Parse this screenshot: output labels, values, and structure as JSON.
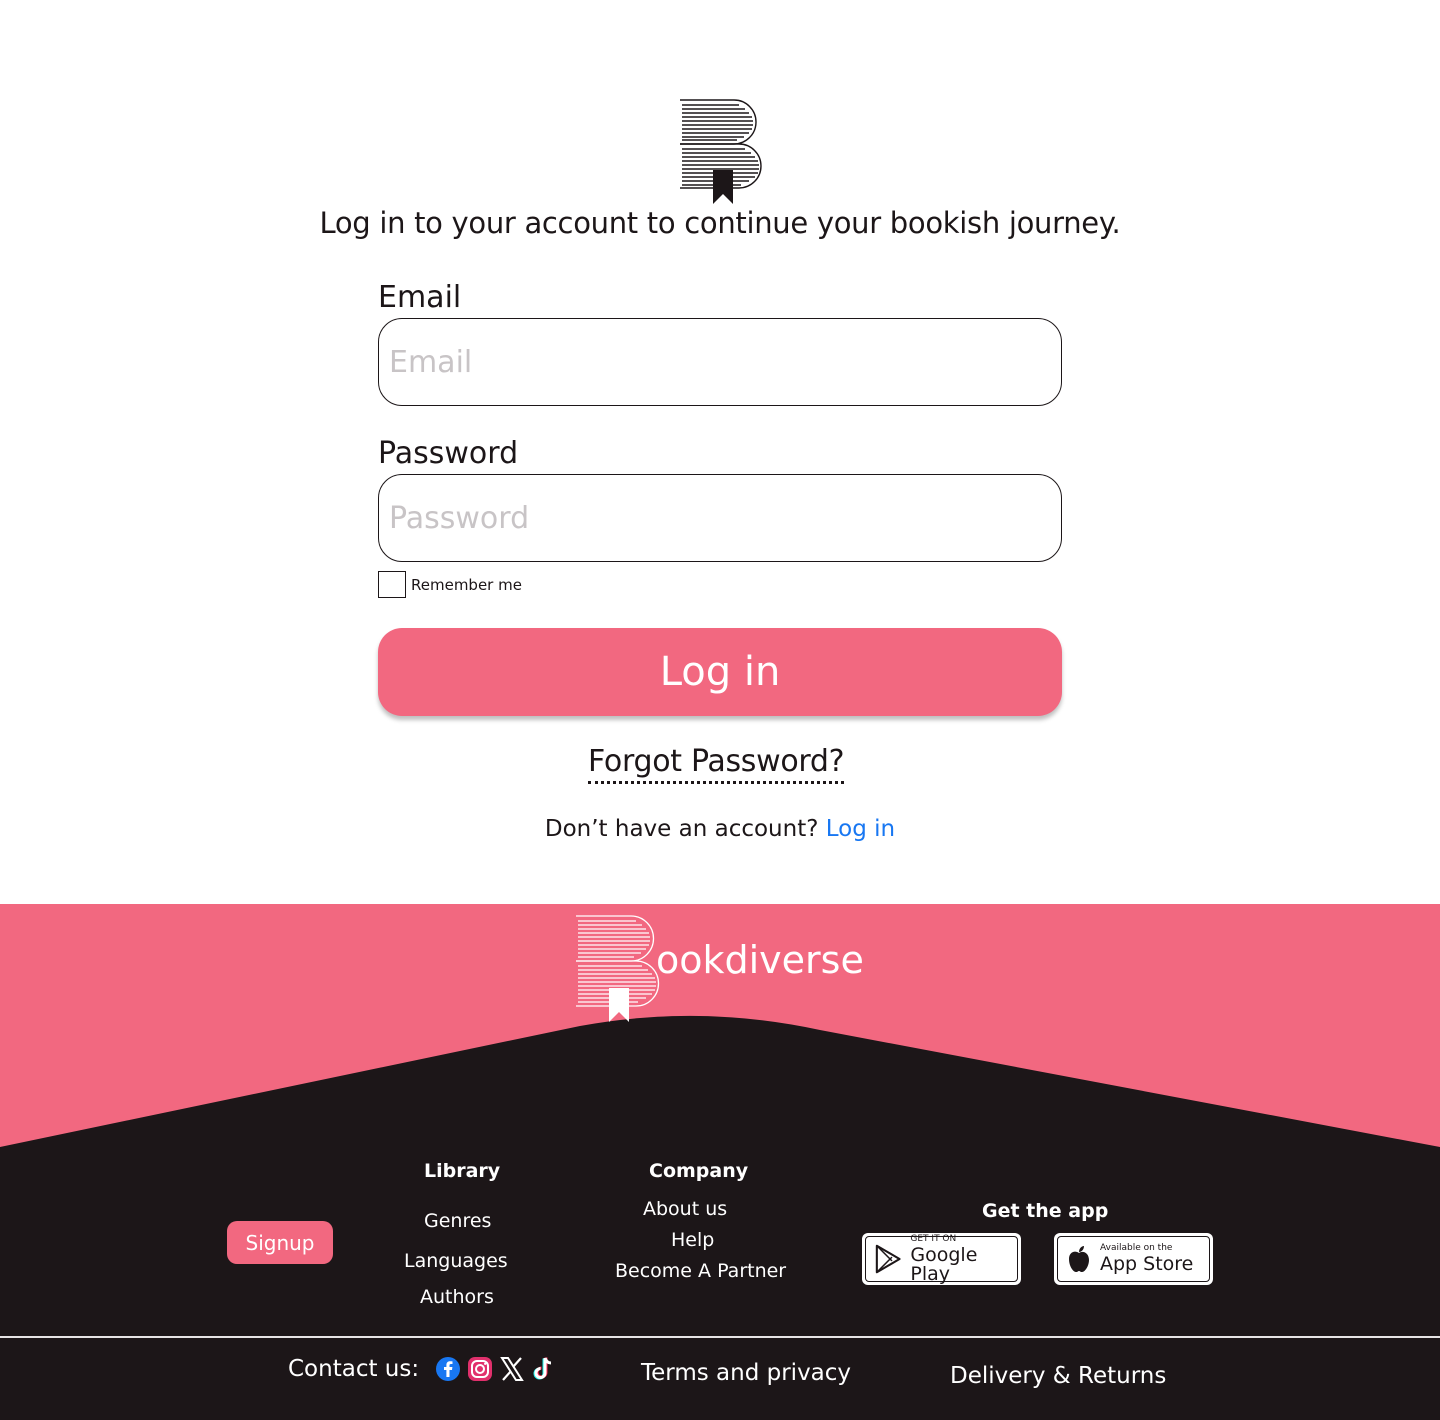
{
  "login": {
    "headline": "Log in to your account to continue your bookish journey.",
    "email_label": "Email",
    "email_placeholder": "Email",
    "email_value": "",
    "password_label": "Password",
    "password_placeholder": "Password",
    "password_value": "",
    "remember_label": "Remember me",
    "remember_checked": false,
    "submit_label": "Log in",
    "forgot_label": "Forgot Password?",
    "no_account_text": "Don’t have an account?",
    "no_account_link": "Log in"
  },
  "footer": {
    "brand_name": "ookdiverse",
    "signup_label": "Signup",
    "library": {
      "title": "Library",
      "items": [
        "Genres",
        "Languages",
        "Authors"
      ]
    },
    "company": {
      "title": "Company",
      "items": [
        "About us",
        "Help",
        "Become A Partner"
      ]
    },
    "get_app": {
      "title": "Get the app",
      "google_small": "GET IT ON",
      "google_big": "Google Play",
      "apple_small": "Available on the",
      "apple_big": "App Store"
    },
    "contact_label": "Contact us:",
    "socials": [
      "facebook-icon",
      "instagram-icon",
      "x-icon",
      "tiktok-icon"
    ],
    "terms_label": "Terms and privacy",
    "delivery_label": "Delivery & Returns"
  },
  "colors": {
    "accent": "#f26880",
    "dark": "#1c1618",
    "link": "#1877f2",
    "placeholder": "#c8c4c6"
  }
}
